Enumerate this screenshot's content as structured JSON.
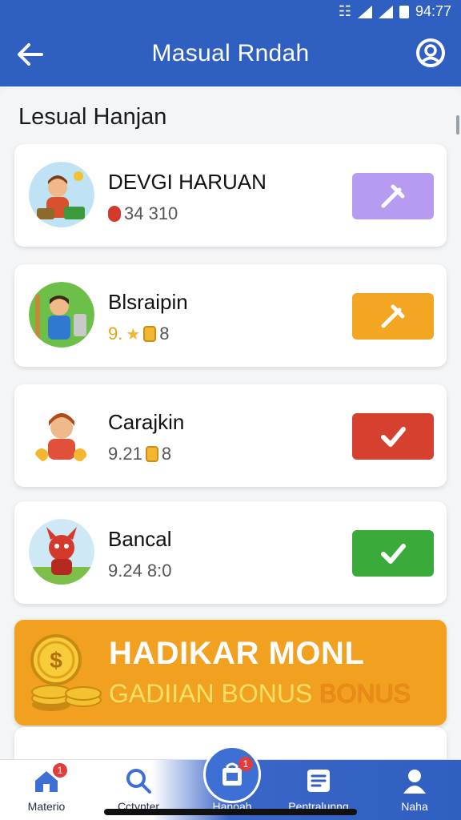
{
  "status_bar": {
    "time": "94:77"
  },
  "app_bar": {
    "title": "Masual Rndah",
    "back_icon": "arrow-left-icon",
    "profile_icon": "user-circle-icon"
  },
  "section": {
    "title": "Lesual Hanjan"
  },
  "items": [
    {
      "name": "DEVGI HARUAN",
      "meta": "34 310",
      "action_color": "#b59cf0",
      "action_icon": "pin-icon"
    },
    {
      "name": "Blsraipin",
      "meta_a": "9.",
      "meta_b": "8",
      "action_color": "#f2a622",
      "action_icon": "pin-icon"
    },
    {
      "name": "Carajkin",
      "meta_a": "9.21",
      "meta_b": "8",
      "action_color": "#d6402e",
      "action_icon": "check-icon"
    },
    {
      "name": "Bancal",
      "meta": "9.24 8:0",
      "action_color": "#3aaa3a",
      "action_icon": "check-icon"
    }
  ],
  "banner": {
    "title": "HADIKAR MONL",
    "sub_main": "GADIIAN BONUS ",
    "sub_accent": "BONUS"
  },
  "bottom_nav": [
    {
      "label": "Materio",
      "icon": "home-icon",
      "badge": "1"
    },
    {
      "label": "Cctynter",
      "icon": "search-icon"
    },
    {
      "label": "Hanoah",
      "icon": "bag-icon",
      "badge": "1"
    },
    {
      "label": "Pentralunng",
      "icon": "list-icon"
    },
    {
      "label": "Naha",
      "icon": "user-icon"
    }
  ],
  "colors": {
    "primary": "#2f5fc0",
    "banner": "#f2a020"
  }
}
